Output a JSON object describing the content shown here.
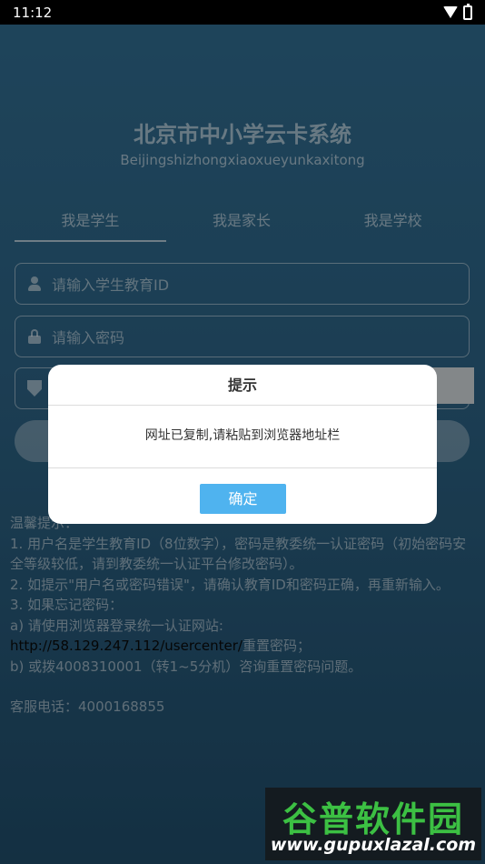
{
  "status_bar": {
    "time": "11:12"
  },
  "app": {
    "title": "北京市中小学云卡系统",
    "subtitle": "Beijingshizhongxiaoxueyunkaxitong"
  },
  "tabs": [
    {
      "label": "我是学生",
      "active": true
    },
    {
      "label": "我是家长",
      "active": false
    },
    {
      "label": "我是学校",
      "active": false
    }
  ],
  "form": {
    "id_placeholder": "请输入学生教育ID",
    "password_placeholder": "请输入密码"
  },
  "tips": {
    "heading": "温馨提示：",
    "line1": "1. 用户名是学生教育ID（8位数字），密码是教委统一认证密码（初始密码安全等级较低，请到教委统一认证平台修改密码）。",
    "line2": "2. 如提示\"用户名或密码错误\"，请确认教育ID和密码正确，再重新输入。",
    "line3": "3. 如果忘记密码：",
    "line3a": "a) 请使用浏览器登录统一认证网站:",
    "url": "http://58.129.247.112/usercenter/",
    "url_suffix": "重置密码；",
    "line3b": "b) 或拨4008310001（转1~5分机）咨询重置密码问题。",
    "hotline": "客服电话：4000168855"
  },
  "dialog": {
    "title": "提示",
    "message": "网址已复制,请粘贴到浏览器地址栏",
    "confirm_label": "确定",
    "confirm_color": "#4fb3ef"
  },
  "watermark": {
    "title": "谷普软件园",
    "url": "www.gupuxlazal.com"
  }
}
